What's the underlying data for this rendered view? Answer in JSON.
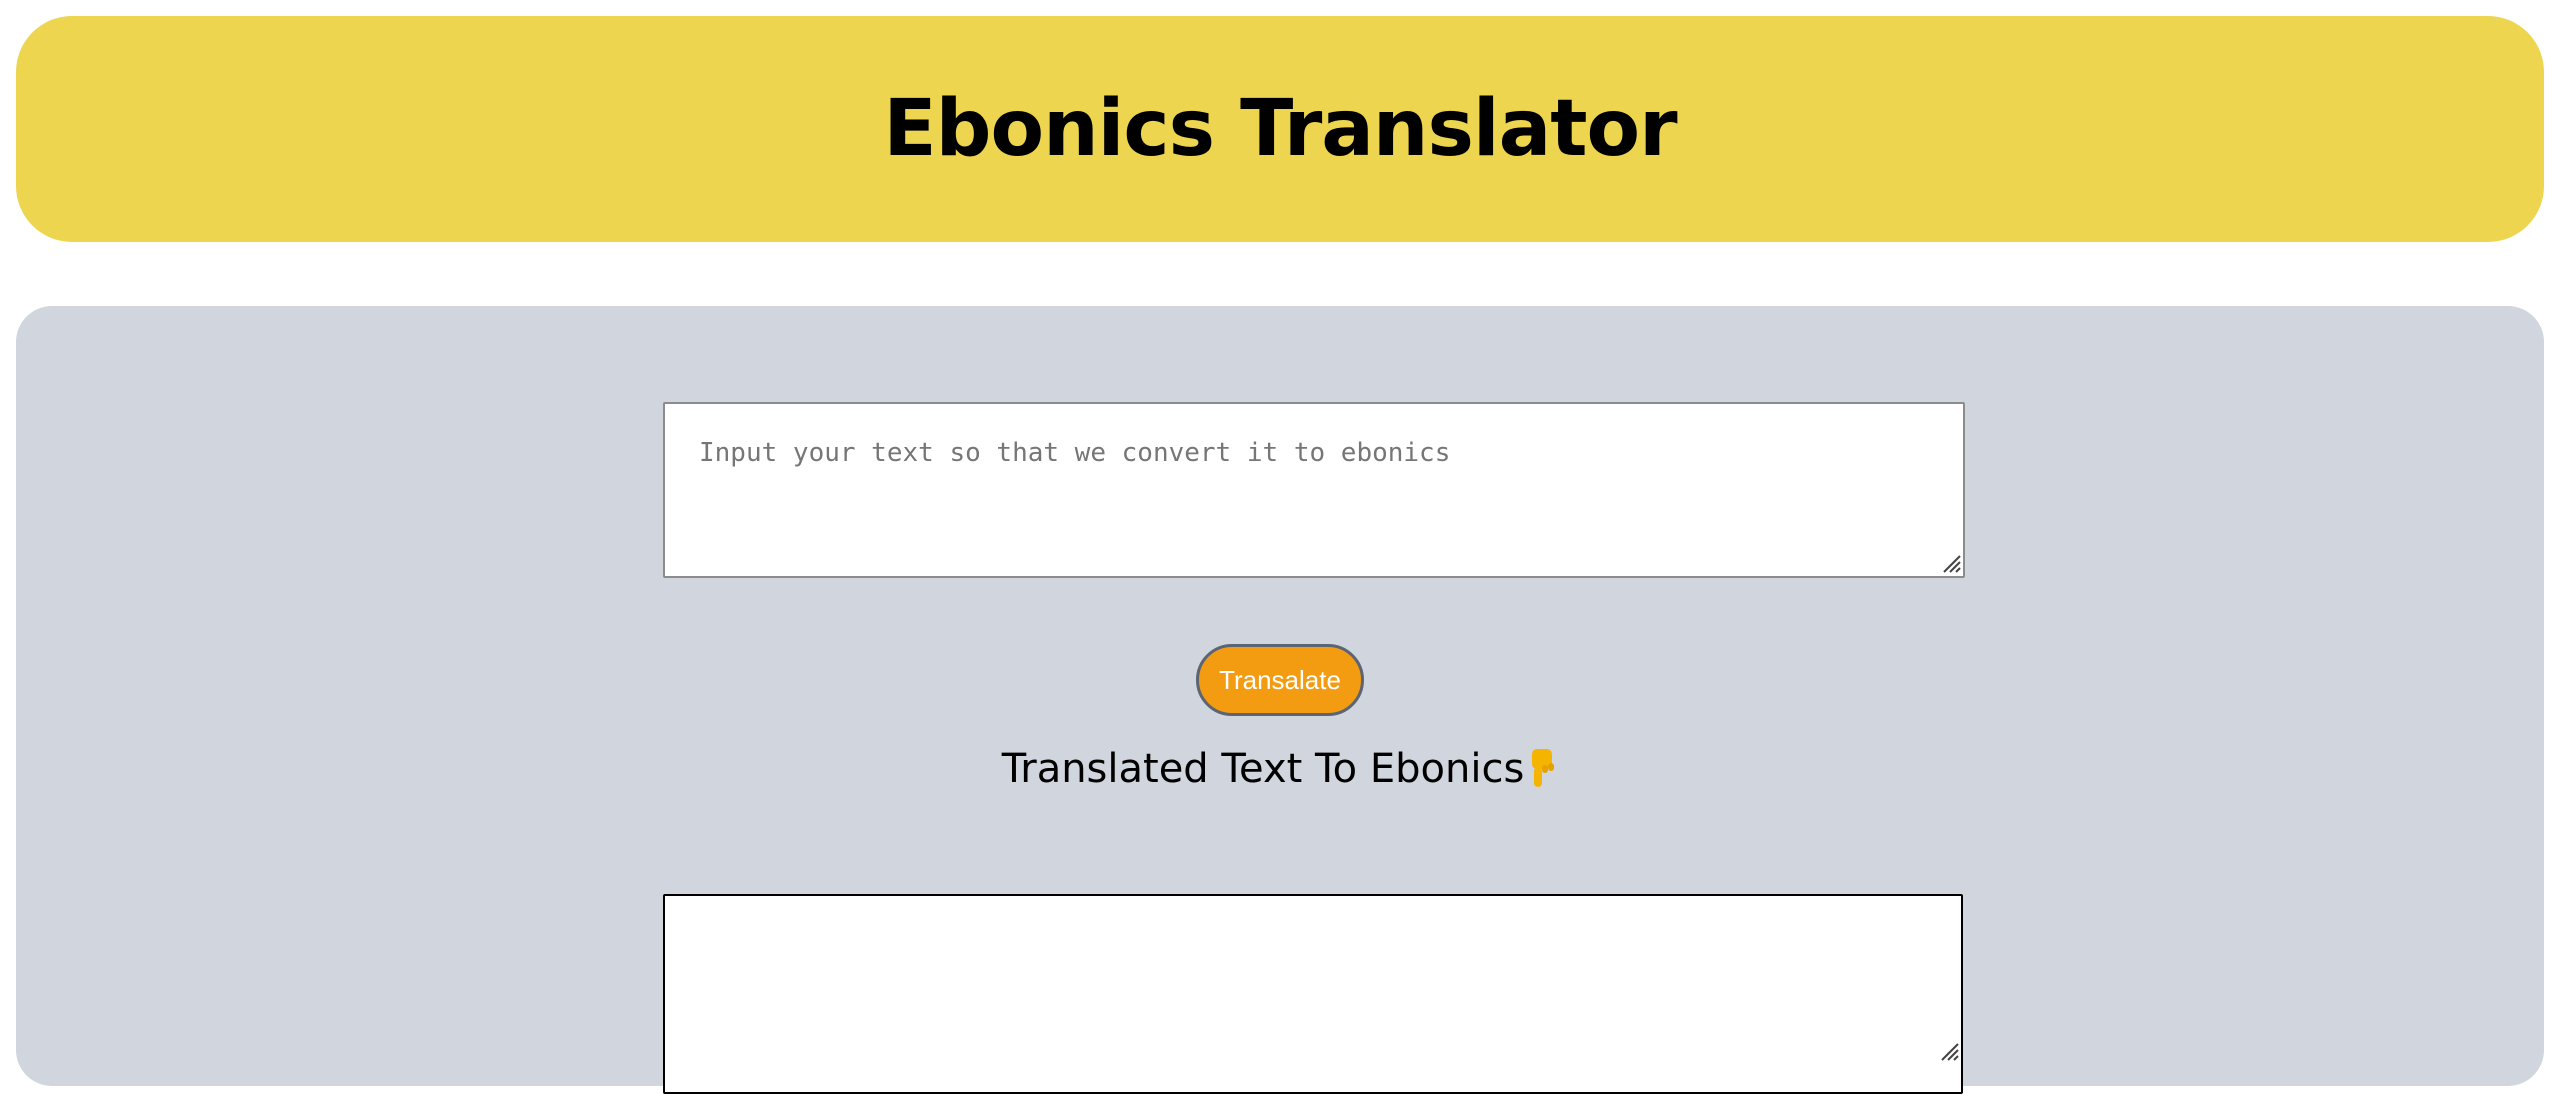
{
  "header": {
    "title": "Ebonics Translator"
  },
  "input": {
    "placeholder": "Input your text so that we convert it to ebonics",
    "value": ""
  },
  "translate_button": {
    "label": "Transalate"
  },
  "result": {
    "heading": "Translated Text To Ebonics",
    "icon": "pointing-down-hand-icon",
    "value": ""
  },
  "colors": {
    "header_bg": "#edd54f",
    "main_bg": "#d1d5dd",
    "button_bg": "#f39c12",
    "button_border": "#5a6474"
  }
}
